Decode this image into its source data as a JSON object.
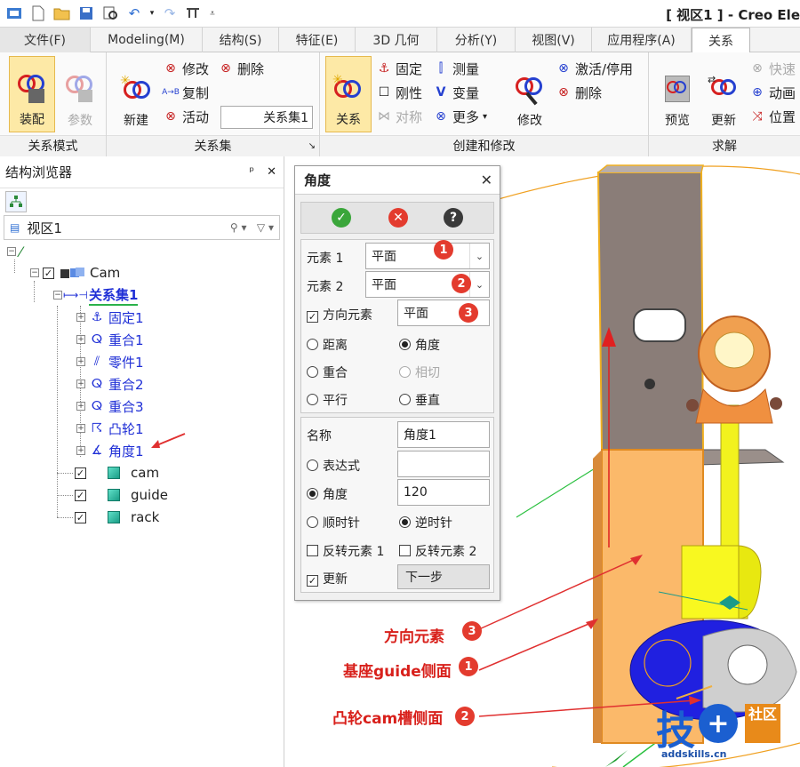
{
  "window": {
    "title": "[ 视区1 ] - Creo Ele"
  },
  "ribbon_tabs": [
    "文件(F)",
    "Modeling(M)",
    "结构(S)",
    "特征(E)",
    "3D 几何",
    "分析(Y)",
    "视图(V)",
    "应用程序(A)",
    "关系"
  ],
  "ribbon": {
    "groups": {
      "relation_mode": "关系模式",
      "relation_set": "关系集",
      "create_modify": "创建和修改",
      "solve": "求解"
    },
    "assemble": "装配",
    "parameter": "参数",
    "new": "新建",
    "modify": "修改",
    "copy": "复制",
    "activate": "活动",
    "delete": "删除",
    "relation_set_name": "关系集1",
    "relation": "关系",
    "fixed": "固定",
    "rigid": "刚性",
    "symmetric": "对称",
    "measure": "测量",
    "variable": "变量",
    "more": "更多",
    "modify2": "修改",
    "activate_deactivate": "激活/停用",
    "delete2": "删除",
    "preview": "预览",
    "update": "更新",
    "quick": "快速",
    "animation": "动画",
    "position": "位置"
  },
  "browser": {
    "title": "结构浏览器",
    "view_name": "视区1",
    "tree": {
      "root": "Cam",
      "relation_set": "关系集1",
      "relations": [
        "固定1",
        "重合1",
        "零件1",
        "重合2",
        "重合3",
        "凸轮1",
        "角度1"
      ],
      "parts": [
        "cam",
        "guide",
        "rack"
      ]
    }
  },
  "dialog": {
    "title": "角度",
    "element1_label": "元素 1",
    "element1_value": "平面",
    "element2_label": "元素 2",
    "element2_value": "平面",
    "direction_label": "方向元素",
    "direction_value": "平面",
    "distance": "距离",
    "angle_type": "角度",
    "coincident": "重合",
    "tangent": "相切",
    "parallel": "平行",
    "perpendicular": "垂直",
    "name_label": "名称",
    "name_value": "角度1",
    "expression": "表达式",
    "angle": "角度",
    "angle_value": "120",
    "clockwise": "顺时针",
    "counterclockwise": "逆时针",
    "reverse1": "反转元素 1",
    "reverse2": "反转元素 2",
    "update": "更新",
    "next": "下一步",
    "badges": [
      "1",
      "2",
      "3"
    ]
  },
  "annotations": [
    {
      "text": "方向元素",
      "badge": "3"
    },
    {
      "text": "基座guide侧面",
      "badge": "1"
    },
    {
      "text": "凸轮cam槽侧面",
      "badge": "2"
    }
  ],
  "watermark": {
    "logo_text": "技",
    "logo_text2": "社区",
    "url": "addskills.cn"
  },
  "colors": {
    "accent_red": "#d8201b",
    "tree_blue": "#1f2fd6",
    "pressed": "#fde9a6"
  }
}
